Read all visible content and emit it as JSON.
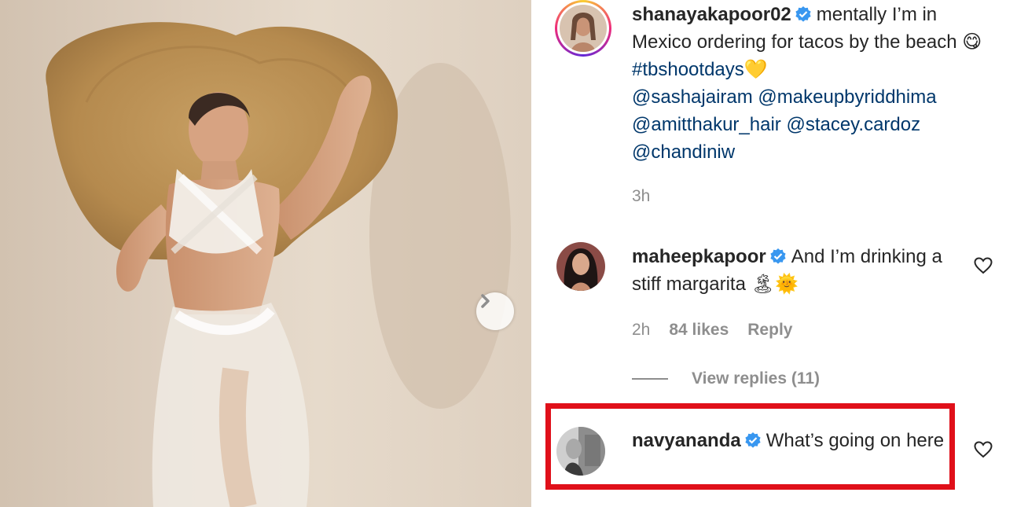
{
  "post": {
    "next_button_icon": "chevron-right-icon"
  },
  "caption": {
    "username": "shanayakapoor02",
    "text_1": "mentally I’m in Mexico ordering for tacos by the beach",
    "emoji_1": "😋",
    "hashtag": "#tbshootdays",
    "emoji_2": "💛",
    "mentions": [
      "@sashajairam",
      "@makeupbyriddhima",
      "@amitthakur_hair",
      "@stacey.cardoz",
      "@chandiniw"
    ],
    "time": "3h"
  },
  "comments": [
    {
      "username": "maheepkapoor",
      "text": "And I’m drinking a stiff margarita",
      "emoji": "🏝🌞",
      "time": "2h",
      "likes": "84 likes",
      "reply_label": "Reply",
      "view_replies": "View replies (11)"
    },
    {
      "username": "navyananda",
      "text": "What’s going on here"
    }
  ],
  "colors": {
    "verified": "#3897f0",
    "link": "#00376b",
    "highlight": "#e0101a"
  }
}
